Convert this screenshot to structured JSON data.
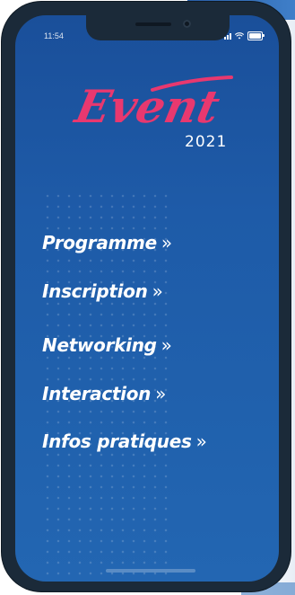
{
  "status_bar": {
    "time": "11:54",
    "signal_icon": "signal-bars-icon",
    "wifi_icon": "wifi-icon",
    "battery_icon": "battery-icon"
  },
  "logo": {
    "word": "Event",
    "year": "2021",
    "word_color": "#e8386f"
  },
  "menu": {
    "items": [
      {
        "label": "Programme",
        "arrow": "»"
      },
      {
        "label": "Inscription",
        "arrow": "»"
      },
      {
        "label": "Networking",
        "arrow": "»"
      },
      {
        "label": "Interaction",
        "arrow": "»"
      },
      {
        "label": "Infos pratiques",
        "arrow": "»"
      }
    ]
  },
  "colors": {
    "screen_top": "#1a4f9a",
    "screen_bottom": "#2366b2",
    "phone_frame": "#1b2a39",
    "text": "#ffffff",
    "accent": "#e8386f"
  }
}
